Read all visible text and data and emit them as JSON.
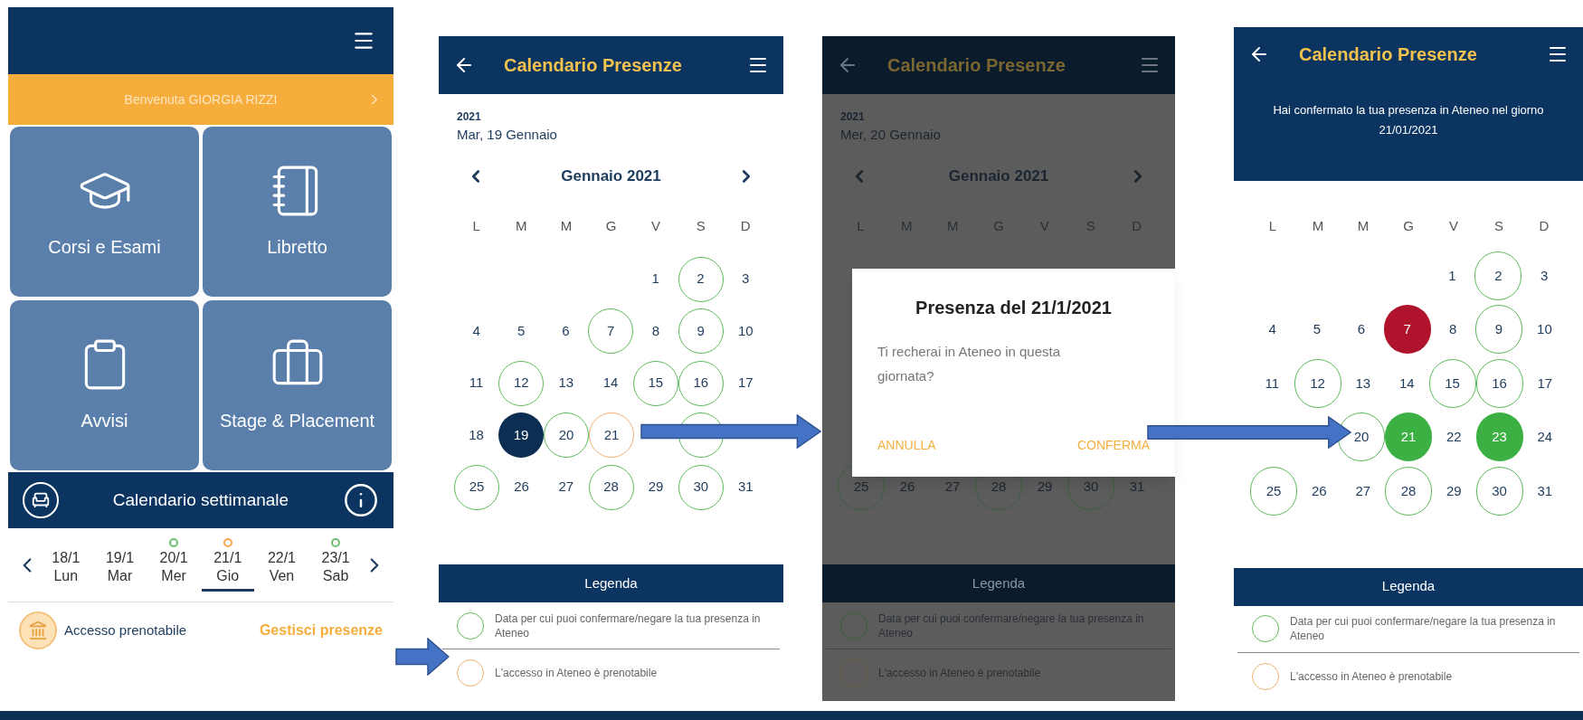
{
  "home": {
    "welcome": "Benvenuta GIORGIA RIZZI",
    "tiles": [
      {
        "label": "Corsi e Esami",
        "kind": "courses"
      },
      {
        "label": "Libretto",
        "kind": "record"
      },
      {
        "label": "Avvisi",
        "kind": "notices"
      },
      {
        "label": "Stage & Placement",
        "kind": "placement"
      }
    ],
    "weekly_calendar": {
      "title": "Calendario settimanale",
      "days": [
        {
          "date": "18/1",
          "day": "Lun",
          "selected": false
        },
        {
          "date": "19/1",
          "day": "Mar",
          "selected": false
        },
        {
          "date": "20/1",
          "day": "Mer",
          "selected": false,
          "color": "#6fbf73"
        },
        {
          "date": "21/1",
          "day": "Gio",
          "selected": true,
          "color": "#f5a54a"
        },
        {
          "date": "22/1",
          "day": "Ven",
          "selected": false
        },
        {
          "date": "23/1",
          "day": "Sab",
          "selected": false,
          "color": "#6fbf73"
        }
      ]
    },
    "access": {
      "label": "Accesso prenotabile",
      "action": "Gestisci presenze"
    }
  },
  "calendar_screen": {
    "title": "Calendario Presenze",
    "year": "2021",
    "date": "Mar, 19 Gennaio",
    "month": "Gennaio 2021",
    "weekdays": [
      "L",
      "M",
      "M",
      "G",
      "V",
      "S",
      "D"
    ],
    "weeks": [
      [
        {
          "kind": "empty"
        },
        {
          "kind": "empty"
        },
        {
          "kind": "empty"
        },
        {
          "kind": "empty"
        },
        {
          "day": "1"
        },
        {
          "day": "2",
          "kind": "ring",
          "color": "#5cb85c"
        },
        {
          "day": "3"
        }
      ],
      [
        {
          "day": "4"
        },
        {
          "day": "5"
        },
        {
          "day": "6"
        },
        {
          "day": "7",
          "kind": "ring",
          "color": "#5cb85c"
        },
        {
          "day": "8"
        },
        {
          "day": "9",
          "kind": "ring",
          "color": "#5cb85c"
        },
        {
          "day": "10"
        }
      ],
      [
        {
          "day": "11"
        },
        {
          "day": "12",
          "kind": "ring",
          "color": "#5cb85c"
        },
        {
          "day": "13"
        },
        {
          "day": "14"
        },
        {
          "day": "15",
          "kind": "ring",
          "color": "#5cb85c"
        },
        {
          "day": "16",
          "kind": "ring",
          "color": "#5cb85c"
        },
        {
          "day": "17"
        }
      ],
      [
        {
          "day": "18"
        },
        {
          "day": "19",
          "kind": "filled",
          "color": "#0b2e52"
        },
        {
          "day": "20",
          "kind": "ring",
          "color": "#5cb85c"
        },
        {
          "day": "21",
          "kind": "ring",
          "color": "#f0b070"
        },
        {
          "kind": "empty"
        },
        {
          "kind": "ring",
          "color": "#5cb85c"
        },
        {
          "kind": "empty"
        }
      ],
      [
        {
          "day": "25",
          "kind": "ring",
          "color": "#5cb85c"
        },
        {
          "day": "26"
        },
        {
          "day": "27"
        },
        {
          "day": "28",
          "kind": "ring",
          "color": "#5cb85c"
        },
        {
          "day": "29"
        },
        {
          "day": "30",
          "kind": "ring",
          "color": "#5cb85c"
        },
        {
          "day": "31"
        }
      ]
    ],
    "legend": {
      "title": "Legenda",
      "items": [
        {
          "text": "Data per cui puoi confermare/negare la tua presenza in Ateneo",
          "color": "#5cb85c"
        },
        {
          "text": "L'accesso in Ateneo è prenotabile",
          "color": "#f0b070"
        }
      ]
    }
  },
  "dialog_screen": {
    "title": "Calendario Presenze",
    "year": "2021",
    "date": "Mer, 20 Gennaio",
    "month": "Gennaio 2021",
    "weekdays": [
      "L",
      "M",
      "M",
      "G",
      "V",
      "S",
      "D"
    ],
    "dialog": {
      "title": "Presenza del 21/1/2021",
      "message": "Ti recherai in Ateneo in questa giornata?",
      "buttons": [
        "ANNULLA",
        "CONFERMA"
      ]
    },
    "weeks": [
      [
        {
          "day": "25",
          "kind": "ring",
          "color": "#3d5e3d"
        },
        {
          "day": "26"
        },
        {
          "day": "27"
        },
        {
          "day": "28",
          "kind": "ring",
          "color": "#3d5e3d"
        },
        {
          "day": "29"
        },
        {
          "day": "30",
          "kind": "ring",
          "color": "#3d5e3d"
        },
        {
          "day": "31"
        }
      ]
    ],
    "legend": {
      "title": "Legenda",
      "items": [
        {
          "text": "Data per cui puoi confermare/negare la tua presenza in Ateneo",
          "color": "#3d5e3d"
        },
        {
          "text": "L'accesso in Ateneo è prenotabile",
          "color": "#6a5a3a"
        }
      ]
    }
  },
  "confirmed_screen": {
    "title": "Calendario Presenze",
    "message": "Hai confermato la tua presenza in Ateneo nel giorno 21/01/2021",
    "weekdays": [
      "L",
      "M",
      "M",
      "G",
      "V",
      "S",
      "D"
    ],
    "weeks": [
      [
        {
          "kind": "empty"
        },
        {
          "kind": "empty"
        },
        {
          "kind": "empty"
        },
        {
          "kind": "empty"
        },
        {
          "day": "1"
        },
        {
          "day": "2",
          "kind": "ring",
          "color": "#5cb85c"
        },
        {
          "day": "3"
        }
      ],
      [
        {
          "day": "4"
        },
        {
          "day": "5"
        },
        {
          "day": "6"
        },
        {
          "day": "7",
          "kind": "filled",
          "color": "#b0142c"
        },
        {
          "day": "8"
        },
        {
          "day": "9",
          "kind": "ring",
          "color": "#5cb85c"
        },
        {
          "day": "10"
        }
      ],
      [
        {
          "day": "11"
        },
        {
          "day": "12",
          "kind": "ring",
          "color": "#5cb85c"
        },
        {
          "day": "13"
        },
        {
          "day": "14"
        },
        {
          "day": "15",
          "kind": "ring",
          "color": "#5cb85c"
        },
        {
          "day": "16",
          "kind": "ring",
          "color": "#5cb85c"
        },
        {
          "day": "17"
        }
      ],
      [
        {
          "kind": "empty"
        },
        {
          "kind": "empty"
        },
        {
          "day": "20",
          "kind": "ring",
          "color": "#5cb85c"
        },
        {
          "day": "21",
          "kind": "filled",
          "color": "#3cb043"
        },
        {
          "day": "22"
        },
        {
          "day": "23",
          "kind": "filled",
          "color": "#3cb043"
        },
        {
          "day": "24"
        }
      ],
      [
        {
          "day": "25",
          "kind": "ring",
          "color": "#5cb85c"
        },
        {
          "day": "26"
        },
        {
          "day": "27"
        },
        {
          "day": "28",
          "kind": "ring",
          "color": "#5cb85c"
        },
        {
          "day": "29"
        },
        {
          "day": "30",
          "kind": "ring",
          "color": "#5cb85c"
        },
        {
          "day": "31"
        }
      ]
    ],
    "legend": {
      "title": "Legenda",
      "items": [
        {
          "text": "Data per cui puoi confermare/negare la tua presenza in Ateneo",
          "color": "#5cb85c"
        },
        {
          "text": "L'accesso in Ateneo è prenotabile",
          "color": "#f0b070"
        }
      ]
    }
  }
}
